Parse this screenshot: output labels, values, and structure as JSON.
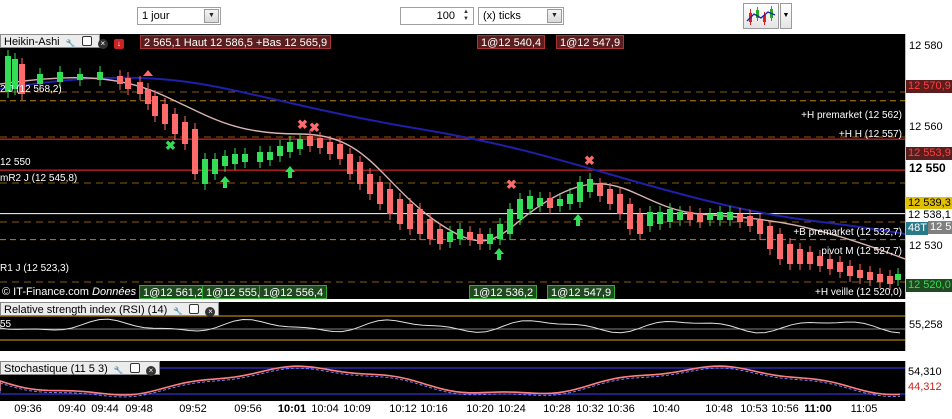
{
  "toolbar": {
    "period_value": "1 jour",
    "ticks_count": "100",
    "ticks_unit": "(x) ticks"
  },
  "main_panel": {
    "title": "Heikin-Ashi",
    "header_tags": [
      {
        "text": "2 565,1 Haut 12 586,5 +Bas 12 565,9",
        "color": "red"
      },
      {
        "text": "1@12 540,4",
        "color": "red"
      },
      {
        "text": "1@12 547,9",
        "color": "red"
      }
    ],
    "bottom_tags": [
      {
        "text": "1@12 561,2",
        "color": "green"
      },
      {
        "text": "1@12 555,4",
        "color": "green"
      },
      {
        "text": "1@12 556,4",
        "color": "green"
      },
      {
        "text": "1@12 536,2",
        "color": "green"
      },
      {
        "text": "1@12 547,9",
        "color": "green"
      }
    ],
    "copyright": "© IT-Finance.com",
    "copyright_suffix": "Données",
    "levels": [
      {
        "label": "+H premarket (12 562)",
        "value": 12562,
        "color": "#ff3030"
      },
      {
        "label": "+H H (12 557)",
        "value": 12557,
        "color": "#ff3030"
      },
      {
        "label": "12 550",
        "value": 12550,
        "color": "#ffffff"
      },
      {
        "label": "mR2 J (12 545,8)",
        "value": 12545.8,
        "color": "#b8860b"
      },
      {
        "label": "+B premarket (12 532,7)",
        "value": 12532.7,
        "color": "#ff3030"
      },
      {
        "label": "pivot M (12 527,7)",
        "value": 12527.7,
        "color": "#ffffff"
      },
      {
        "label": "R1 J (12 523,3)",
        "value": 12523.3,
        "color": "#b8860b"
      },
      {
        "label": "+H veille (12 520,0)",
        "value": 12520.0,
        "color": "#ffffff"
      },
      {
        "label": "2 J (12 568,2)",
        "value": 12568.2,
        "color": "#b8860b"
      }
    ],
    "axis_labels": [
      "12 580",
      "12 570,9",
      "12 560",
      "12 553,9",
      "12 550",
      "12 539,3",
      "12 538,1",
      "12 537,2",
      "48T",
      "12 530",
      "12 520,0"
    ]
  },
  "rsi_panel": {
    "title": "Relative strength index (RSI) (14)",
    "value": "55,258",
    "left_value": "55"
  },
  "stoch_panel": {
    "title": "Stochastique (11 5 3)",
    "value_top": "54,310",
    "value_bottom": "44,312"
  },
  "time_labels": [
    "09:36",
    "09:40",
    "09:44",
    "09:48",
    "09:52",
    "09:56",
    "10:01",
    "10:04",
    "10:09",
    "10:12",
    "10:16",
    "10:20",
    "10:24",
    "10:28",
    "10:32",
    "10:36",
    "10:40",
    "10:48",
    "10:53",
    "10:56",
    "11:00",
    "11:05"
  ],
  "colors": {
    "up": "#33dd55",
    "down": "#ff6a6a",
    "ma_fast": "#d9b3b3",
    "ma_slow": "#1f1fa8",
    "background": "#000000"
  }
}
